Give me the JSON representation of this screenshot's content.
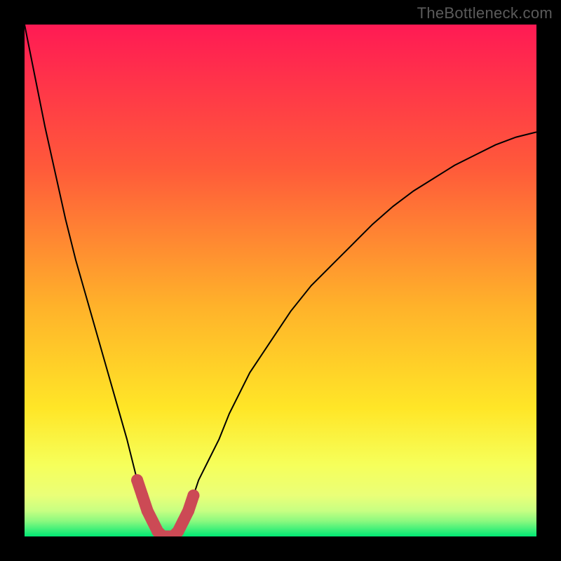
{
  "watermark": "TheBottleneck.com",
  "chart_data": {
    "type": "line",
    "title": "",
    "xlabel": "",
    "ylabel": "",
    "xlim": [
      0,
      100
    ],
    "ylim": [
      0,
      100
    ],
    "grid": false,
    "legend": false,
    "background_gradient": {
      "top": "#ff1a54",
      "mid": "#ffd324",
      "band": "#f8ff64",
      "bottom": "#00e874"
    },
    "series": [
      {
        "name": "curve",
        "stroke": "#000000",
        "x": [
          0,
          2,
          4,
          6,
          8,
          10,
          12,
          14,
          16,
          18,
          20,
          21,
          22,
          23,
          24,
          25,
          26,
          27,
          28,
          29,
          30,
          31,
          32,
          33,
          34,
          36,
          38,
          40,
          44,
          48,
          52,
          56,
          60,
          64,
          68,
          72,
          76,
          80,
          84,
          88,
          92,
          96,
          100
        ],
        "values": [
          100,
          90,
          80,
          71,
          62,
          54,
          47,
          40,
          33,
          26,
          19,
          15,
          11,
          8,
          5,
          3,
          1,
          0,
          0,
          0,
          1,
          3,
          5,
          8,
          11,
          15,
          19,
          24,
          32,
          38,
          44,
          49,
          53,
          57,
          61,
          64.5,
          67.5,
          70,
          72.5,
          74.5,
          76.5,
          78,
          79
        ]
      },
      {
        "name": "marker-cluster",
        "stroke": "#cc4a55",
        "x": [
          22,
          23,
          24,
          25,
          26,
          27,
          28,
          29,
          30,
          31,
          32,
          33
        ],
        "values": [
          11,
          8,
          5,
          3,
          1,
          0,
          0,
          0,
          1,
          3,
          5,
          8
        ]
      }
    ]
  }
}
